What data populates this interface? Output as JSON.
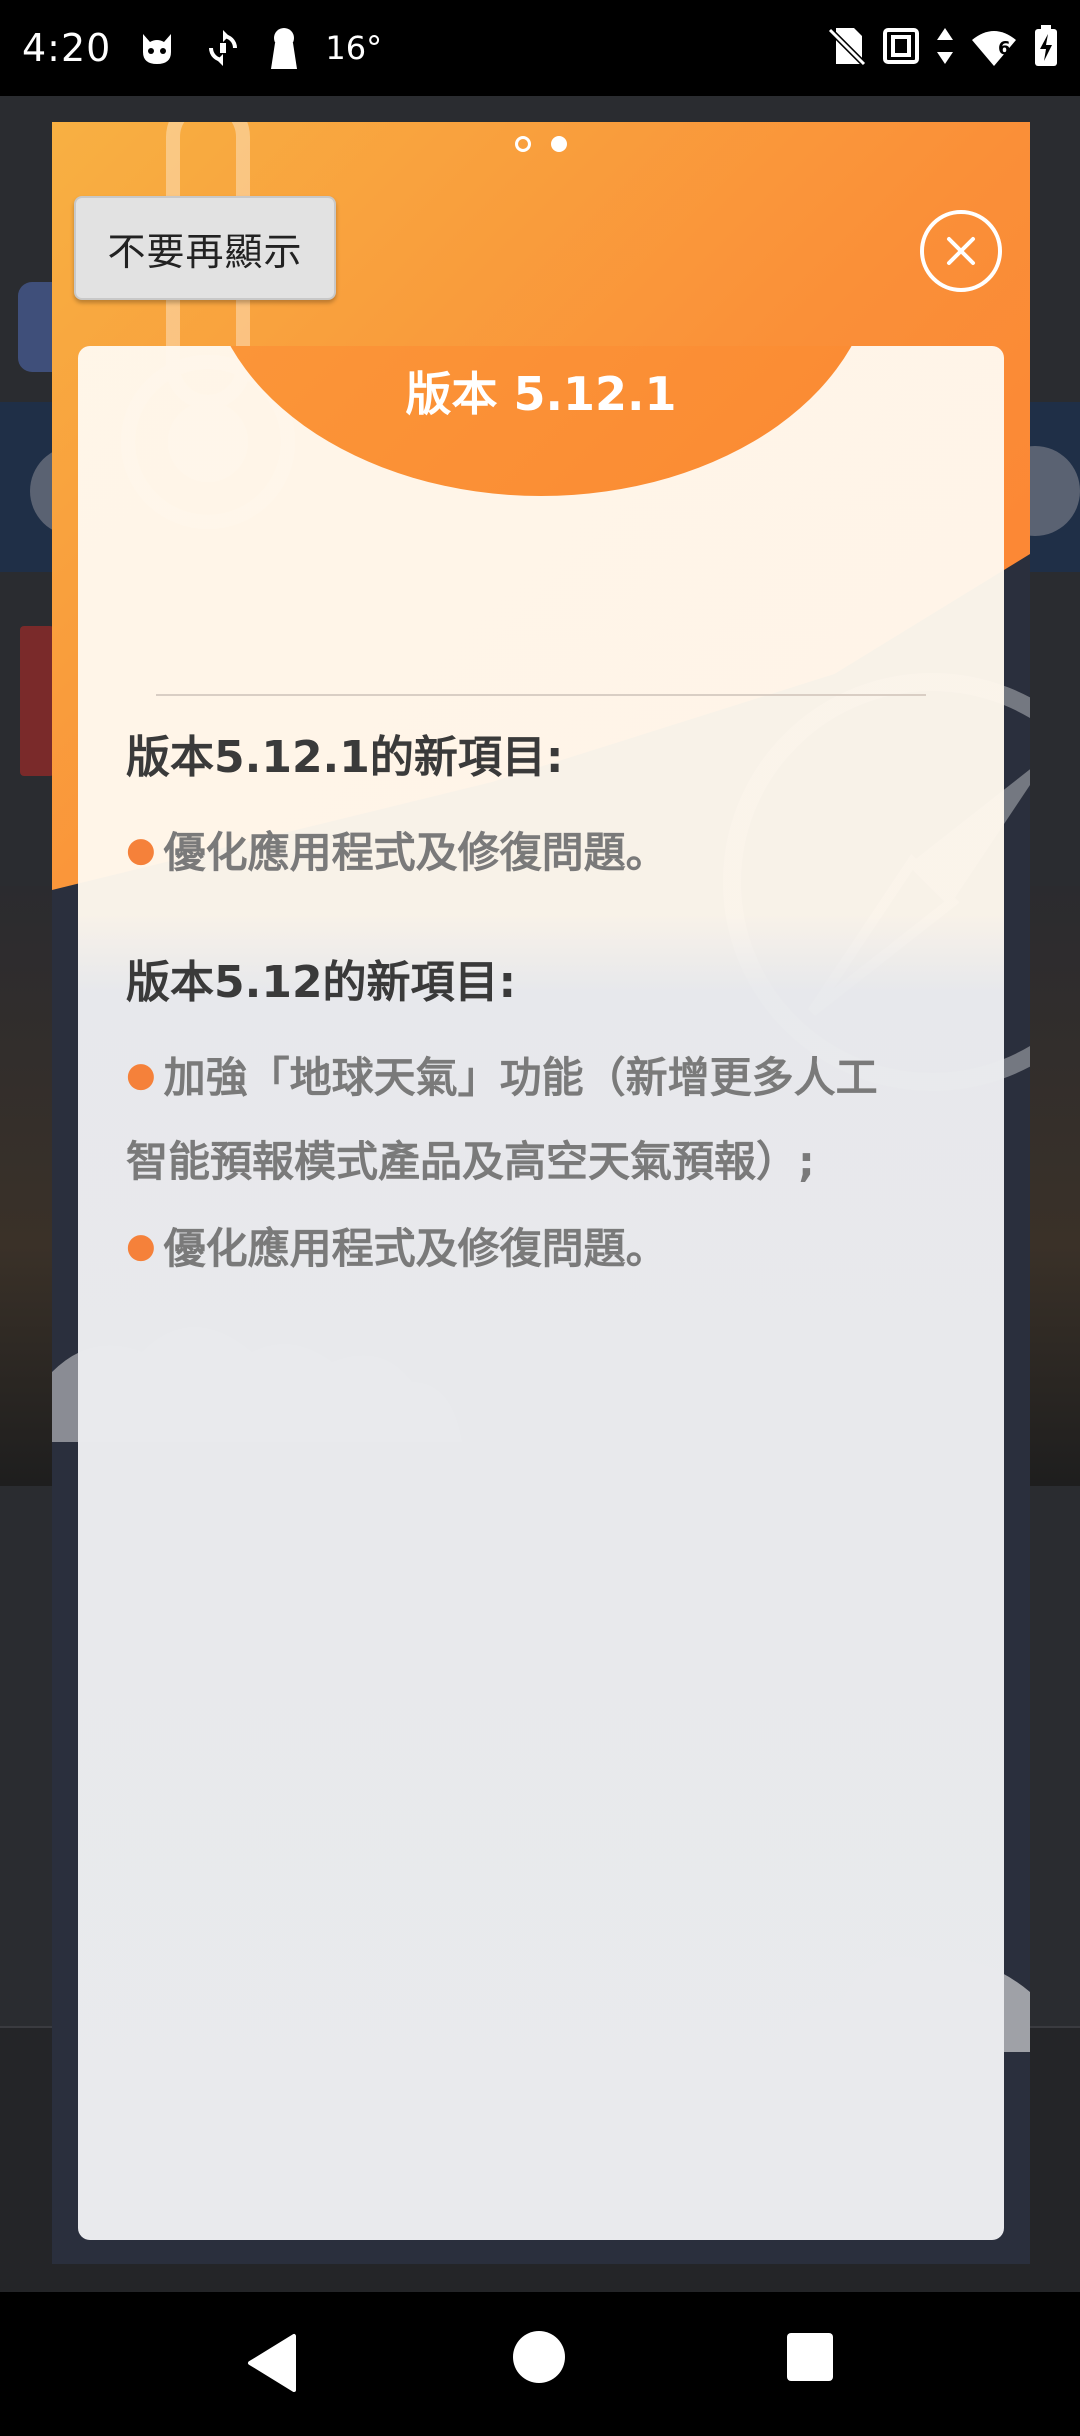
{
  "status_bar": {
    "time": "4:20",
    "temperature": "16°",
    "icons": [
      "cat-icon",
      "sync-icon",
      "keyhole-icon",
      "no-sim-icon",
      "nfc-icon",
      "data-arrows-icon",
      "wifi-icon",
      "battery-charging-icon"
    ],
    "signal_label": "6"
  },
  "dialog": {
    "pager": {
      "total": 2,
      "current": 2
    },
    "dont_show_label": "不要再顯示",
    "close_icon": "close-circle-icon",
    "title": "版本 5.12.1",
    "sections": [
      {
        "heading": "版本5.12.1的新項目:",
        "lines": [
          "優化應用程式及修復問題。"
        ]
      },
      {
        "heading": "版本5.12的新項目:",
        "lines": [
          "加強「地球天氣」功能（新增更多人工",
          "智能預報模式產品及高空天氣預報）;",
          "優化應用程式及修復問題。"
        ]
      }
    ],
    "colors": {
      "accent_orange": "#fa8f38",
      "bullet": "#f5813a",
      "card_bg": "#e9eaed"
    }
  },
  "nav_bar": {
    "icons": [
      "back-icon",
      "home-icon",
      "recents-icon"
    ]
  }
}
